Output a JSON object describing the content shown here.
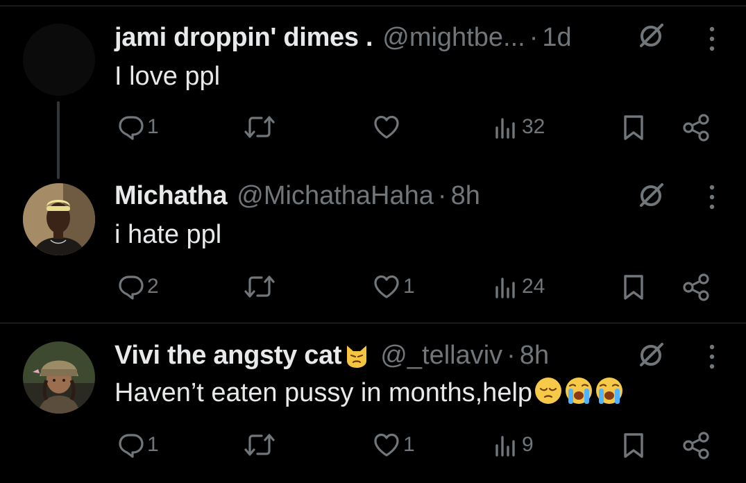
{
  "posts": [
    {
      "name": "jami droppin' dimes .",
      "handle": "@mightbe...",
      "time": "1d",
      "text": "I love ppl",
      "stats": {
        "replies": "1",
        "reposts": "",
        "likes": "",
        "views": "32"
      }
    },
    {
      "name": "Michatha",
      "handle": "@MichathaHaha",
      "time": "8h",
      "text": "i hate ppl",
      "stats": {
        "replies": "2",
        "reposts": "",
        "likes": "1",
        "views": "24"
      }
    },
    {
      "name": "Vivi the angsty cat",
      "handle": "@_tellaviv",
      "time": "8h",
      "text": "Haven’t eaten pussy in months,help",
      "stats": {
        "replies": "1",
        "reposts": "",
        "likes": "1",
        "views": "9"
      }
    }
  ],
  "separator": "·",
  "icons": {
    "reply": "reply-icon",
    "repost": "repost-icon",
    "like": "like-icon",
    "views": "views-icon",
    "bookmark": "bookmark-icon",
    "share": "share-icon",
    "grok": "grok-icon",
    "more": "more-icon"
  },
  "colors": {
    "background": "#000000",
    "text": "#e7e9ea",
    "muted": "#71767b",
    "divider": "#2f3336"
  }
}
